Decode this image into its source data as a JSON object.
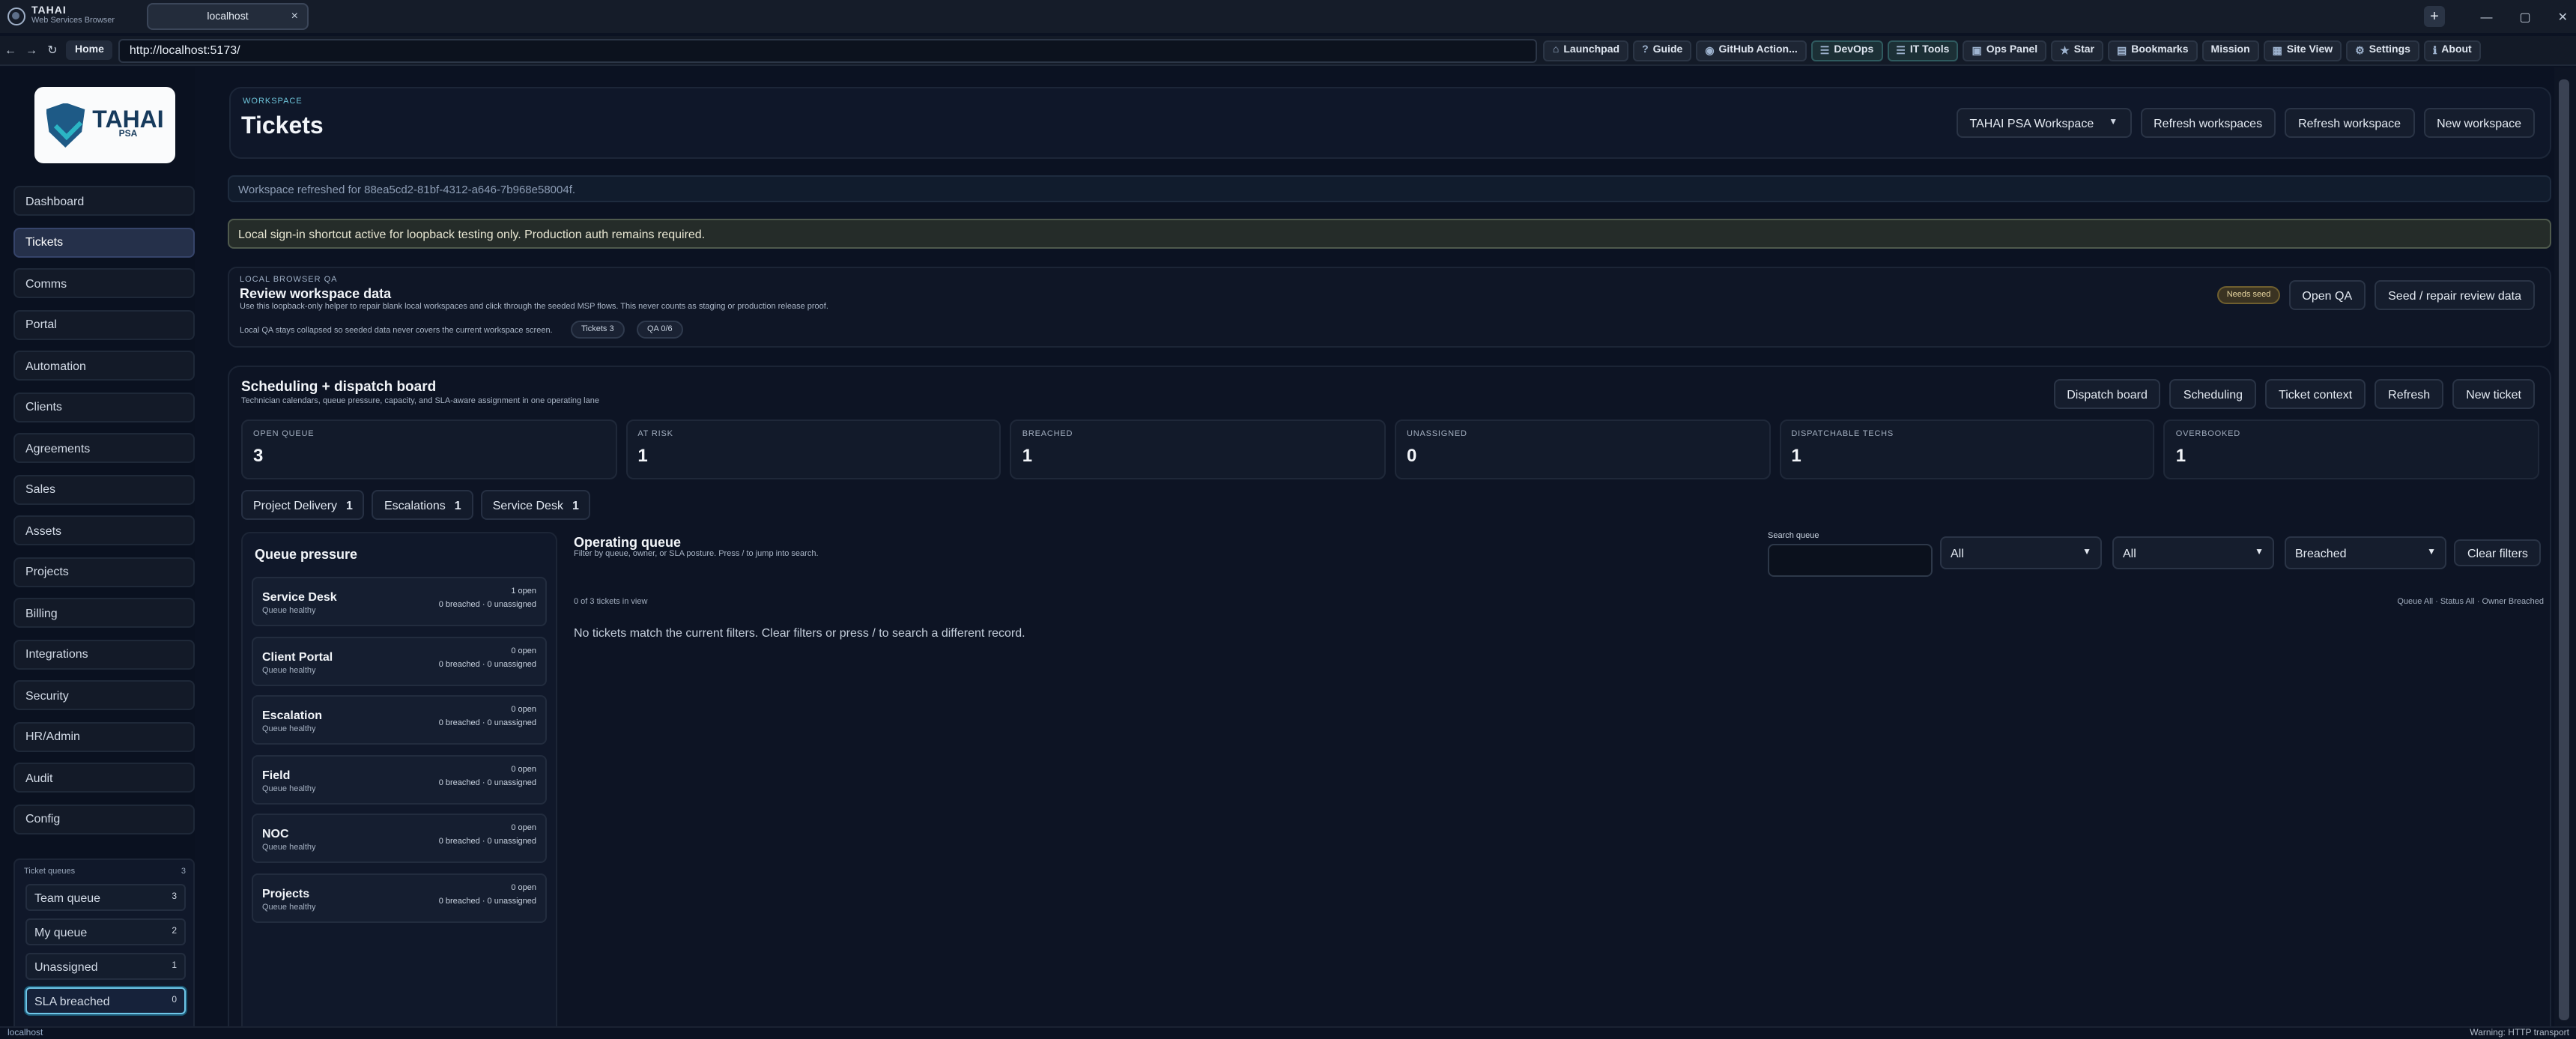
{
  "browser": {
    "brand_name": "TAHAI",
    "brand_sub": "Web Services Browser",
    "tab_title": "localhost",
    "tab_close": "×",
    "new_tab": "+",
    "window_controls": [
      "—",
      "▢",
      "✕"
    ],
    "back": "←",
    "forward": "→",
    "reload": "↻",
    "home": "Home",
    "url": "http://localhost:5173/",
    "tools": [
      {
        "icon": "⌂",
        "label": "Launchpad",
        "on": false
      },
      {
        "icon": "?",
        "label": "Guide",
        "on": false
      },
      {
        "icon": "◉",
        "label": "GitHub Action...",
        "on": false
      },
      {
        "icon": "☰",
        "label": "DevOps",
        "on": true
      },
      {
        "icon": "☰",
        "label": "IT Tools",
        "on": true
      },
      {
        "icon": "▣",
        "label": "Ops Panel",
        "on": false
      },
      {
        "icon": "★",
        "label": "Star",
        "on": false
      },
      {
        "icon": "▤",
        "label": "Bookmarks",
        "on": false
      },
      {
        "icon": "",
        "label": "Mission",
        "on": false
      },
      {
        "icon": "▦",
        "label": "Site View",
        "on": false
      },
      {
        "icon": "⚙",
        "label": "Settings",
        "on": false
      },
      {
        "icon": "ℹ",
        "label": "About",
        "on": false
      }
    ]
  },
  "logo": {
    "title": "TAHAI",
    "sub": "PSA"
  },
  "sidebar": {
    "items": [
      {
        "label": "Dashboard",
        "active": false
      },
      {
        "label": "Tickets",
        "active": true
      },
      {
        "label": "Comms",
        "active": false
      },
      {
        "label": "Portal",
        "active": false
      },
      {
        "label": "Automation",
        "active": false
      },
      {
        "label": "Clients",
        "active": false
      },
      {
        "label": "Agreements",
        "active": false
      },
      {
        "label": "Sales",
        "active": false
      },
      {
        "label": "Assets",
        "active": false
      },
      {
        "label": "Projects",
        "active": false
      },
      {
        "label": "Billing",
        "active": false
      },
      {
        "label": "Integrations",
        "active": false
      },
      {
        "label": "Security",
        "active": false
      },
      {
        "label": "HR/Admin",
        "active": false
      },
      {
        "label": "Audit",
        "active": false
      },
      {
        "label": "Config",
        "active": false
      }
    ],
    "queues_title": "Ticket queues",
    "queues_count": "3",
    "queues": [
      {
        "label": "Team queue",
        "count": "3"
      },
      {
        "label": "My queue",
        "count": "2"
      },
      {
        "label": "Unassigned",
        "count": "1"
      },
      {
        "label": "SLA breached",
        "count": "0"
      }
    ]
  },
  "header": {
    "eyebrow": "WORKSPACE",
    "title": "Tickets",
    "workspace_select": "TAHAI PSA Workspace",
    "refresh_workspaces": "Refresh workspaces",
    "refresh_workspace": "Refresh workspace",
    "new_workspace": "New workspace"
  },
  "notices": {
    "refreshed": "Workspace refreshed for 88ea5cd2-81bf-4312-a646-7b968e58004f.",
    "signin": "Local sign-in shortcut active for loopback testing only. Production auth remains required."
  },
  "qa": {
    "eyebrow": "LOCAL BROWSER QA",
    "title": "Review workspace data",
    "desc": "Use this loopback-only helper to repair blank local workspaces and click through the seeded MSP flows. This never counts as staging or production release proof.",
    "note": "Local QA stays collapsed so seeded data never covers the current workspace screen.",
    "pill_tickets": "Tickets 3",
    "pill_qa": "QA 0/6",
    "badge": "Needs seed",
    "open_qa": "Open QA",
    "seed": "Seed / repair review data"
  },
  "schedule": {
    "title": "Scheduling + dispatch board",
    "desc": "Technician calendars, queue pressure, capacity, and SLA-aware assignment in one operating lane",
    "actions": [
      "Dispatch board",
      "Scheduling",
      "Ticket context",
      "Refresh",
      "New ticket"
    ],
    "stats": [
      {
        "label": "OPEN QUEUE",
        "value": "3"
      },
      {
        "label": "AT RISK",
        "value": "1"
      },
      {
        "label": "BREACHED",
        "value": "1"
      },
      {
        "label": "UNASSIGNED",
        "value": "0"
      },
      {
        "label": "DISPATCHABLE TECHS",
        "value": "1"
      },
      {
        "label": "OVERBOOKED",
        "value": "1"
      }
    ],
    "chips": [
      {
        "label": "Project Delivery",
        "count": "1"
      },
      {
        "label": "Escalations",
        "count": "1"
      },
      {
        "label": "Service Desk",
        "count": "1"
      }
    ]
  },
  "pressure": {
    "title": "Queue pressure",
    "items": [
      {
        "name": "Service Desk",
        "status": "Queue healthy",
        "open": "1 open",
        "breach": "0 breached · 0 unassigned"
      },
      {
        "name": "Client Portal",
        "status": "Queue healthy",
        "open": "0 open",
        "breach": "0 breached · 0 unassigned"
      },
      {
        "name": "Escalation",
        "status": "Queue healthy",
        "open": "0 open",
        "breach": "0 breached · 0 unassigned"
      },
      {
        "name": "Field",
        "status": "Queue healthy",
        "open": "0 open",
        "breach": "0 breached · 0 unassigned"
      },
      {
        "name": "NOC",
        "status": "Queue healthy",
        "open": "0 open",
        "breach": "0 breached · 0 unassigned"
      },
      {
        "name": "Projects",
        "status": "Queue healthy",
        "open": "0 open",
        "breach": "0 breached · 0 unassigned"
      }
    ]
  },
  "opqueue": {
    "title": "Operating queue",
    "desc": "Filter by queue, owner, or SLA posture. Press / to jump into search.",
    "search_label": "Search queue",
    "search_value": "",
    "filter_queue": "All",
    "filter_status": "All",
    "filter_owner": "Breached",
    "clear": "Clear filters",
    "count": "0 of 3 tickets in view",
    "meta": "Queue All · Status All · Owner Breached",
    "empty": "No tickets match the current filters. Clear filters or press / to search a different record."
  },
  "status": {
    "left": "localhost",
    "right": "Warning: HTTP transport"
  }
}
